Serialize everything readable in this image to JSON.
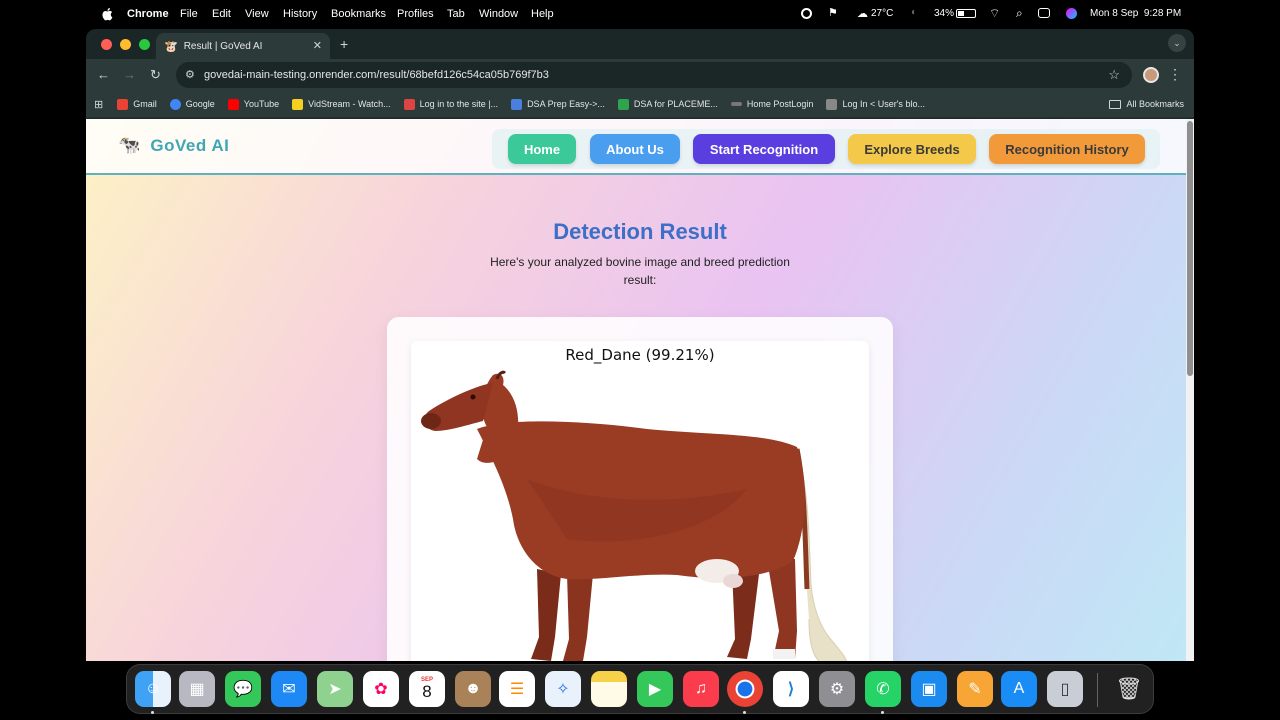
{
  "menubar": {
    "app_name": "Chrome",
    "menus": [
      "File",
      "Edit",
      "View",
      "History",
      "Bookmarks",
      "Profiles",
      "Tab",
      "Window",
      "Help"
    ],
    "weather": "27°C",
    "battery": "34%",
    "datetime": "Mon 8 Sep  9:28 PM"
  },
  "browser": {
    "tab_title": "Result | GoVed AI",
    "url": "govedai-main-testing.onrender.com/result/68befd126c54ca05b769f7b3",
    "bookmarks": [
      {
        "label": "Gmail",
        "color": "#ea4335"
      },
      {
        "label": "Google",
        "color": "#4285f4"
      },
      {
        "label": "YouTube",
        "color": "#ff0000"
      },
      {
        "label": "VidStream - Watch...",
        "color": "#f5d020"
      },
      {
        "label": "Log in to the site |...",
        "color": "#d44"
      },
      {
        "label": "DSA Prep Easy->...",
        "color": "#4a7fe0"
      },
      {
        "label": "DSA for PLACEME...",
        "color": "#2ea44f"
      },
      {
        "label": "Home PostLogin",
        "color": "#777"
      },
      {
        "label": "Log In < User's blo...",
        "color": "#888"
      }
    ],
    "all_bookmarks": "All Bookmarks"
  },
  "site": {
    "logo_text": "GoVed AI",
    "nav": {
      "home": "Home",
      "about": "About Us",
      "start": "Start Recognition",
      "explore": "Explore Breeds",
      "history": "Recognition History"
    },
    "title": "Detection Result",
    "subtitle": "Here's your analyzed bovine image and breed prediction result:",
    "prediction": "Red_Dane (99.21%)"
  },
  "dock": {
    "calendar_month": "SEP",
    "calendar_day": "8"
  }
}
